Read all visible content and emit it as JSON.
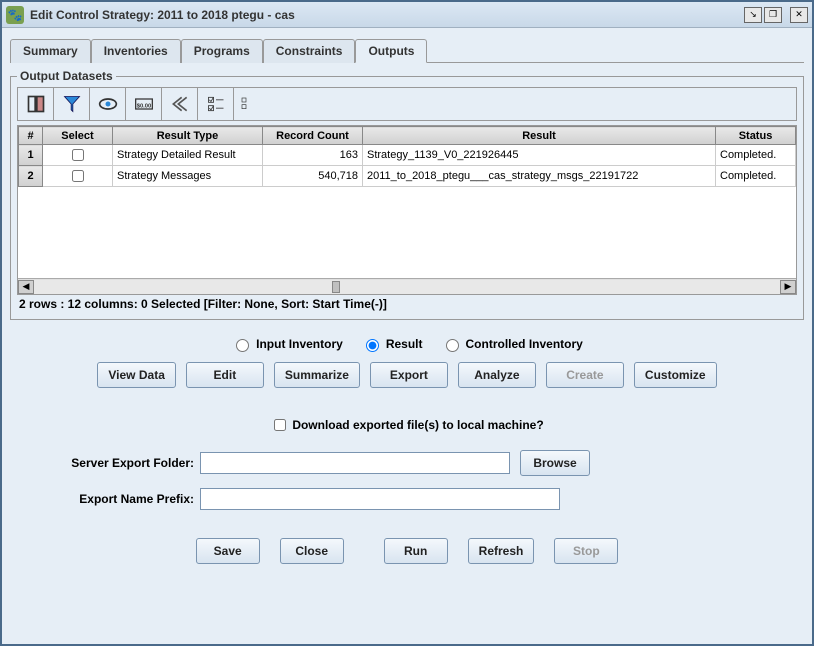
{
  "window": {
    "title": "Edit Control Strategy: 2011 to 2018 ptegu - cas"
  },
  "tabs": [
    "Summary",
    "Inventories",
    "Programs",
    "Constraints",
    "Outputs"
  ],
  "activeTab": "Outputs",
  "fieldset_title": "Output Datasets",
  "table": {
    "headers": [
      "#",
      "Select",
      "Result Type",
      "Record Count",
      "Result",
      "Status"
    ],
    "rows": [
      {
        "n": "1",
        "type": "Strategy Detailed Result",
        "count": "163",
        "result": "Strategy_1139_V0_221926445",
        "status": "Completed."
      },
      {
        "n": "2",
        "type": "Strategy Messages",
        "count": "540,718",
        "result": "2011_to_2018_ptegu___cas_strategy_msgs_22191722",
        "status": "Completed."
      }
    ]
  },
  "status_line": "2 rows : 12 columns: 0 Selected [Filter: None, Sort: Start Time(-)]",
  "radios": {
    "input_inventory": "Input Inventory",
    "result": "Result",
    "controlled_inventory": "Controlled Inventory",
    "selected": "result"
  },
  "action_buttons": {
    "view_data": "View Data",
    "edit": "Edit",
    "summarize": "Summarize",
    "export": "Export",
    "analyze": "Analyze",
    "create": "Create",
    "customize": "Customize"
  },
  "download_label": "Download exported file(s) to local machine?",
  "server_export_folder_label": "Server Export Folder:",
  "server_export_folder_value": "",
  "browse_label": "Browse",
  "export_name_prefix_label": "Export Name Prefix:",
  "export_name_prefix_value": "",
  "bottom": {
    "save": "Save",
    "close": "Close",
    "run": "Run",
    "refresh": "Refresh",
    "stop": "Stop"
  }
}
